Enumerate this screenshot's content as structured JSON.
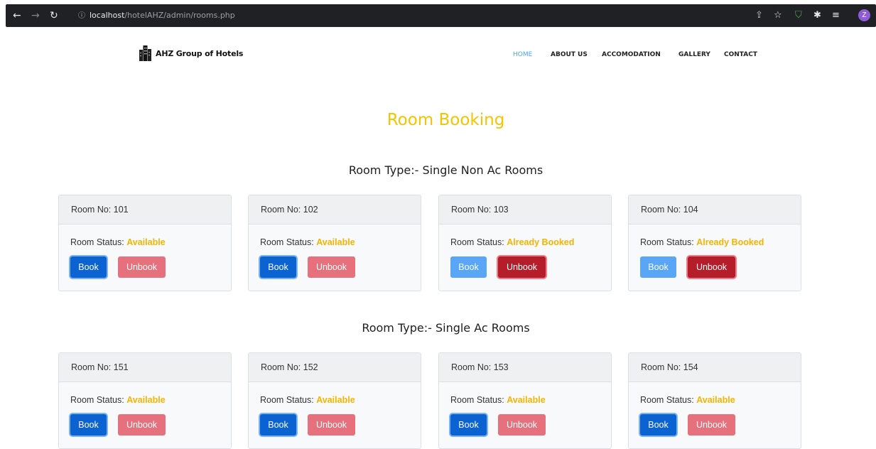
{
  "browser": {
    "url_host": "localhost",
    "url_path": "/hotelAHZ/admin/rooms.php",
    "profile_initial": "Z"
  },
  "site": {
    "brand": "AHZ Group of Hotels",
    "nav": [
      "HOME",
      "ABOUT US",
      "ACCOMODATION",
      "GALLERY",
      "CONTACT"
    ],
    "active_nav": "HOME"
  },
  "page": {
    "title": "Room Booking"
  },
  "sections": [
    {
      "heading": "Room Type:- Single Non Ac Rooms",
      "rooms": [
        {
          "label": "Room No: 101",
          "status_label": "Room Status:",
          "status": "Available",
          "book_enabled": true
        },
        {
          "label": "Room No: 102",
          "status_label": "Room Status:",
          "status": "Available",
          "book_enabled": true
        },
        {
          "label": "Room No: 103",
          "status_label": "Room Status:",
          "status": "Already Booked",
          "book_enabled": false
        },
        {
          "label": "Room No: 104",
          "status_label": "Room Status:",
          "status": "Already Booked",
          "book_enabled": false
        }
      ]
    },
    {
      "heading": "Room Type:- Single Ac Rooms",
      "rooms": [
        {
          "label": "Room No: 151",
          "status_label": "Room Status:",
          "status": "Available",
          "book_enabled": true
        },
        {
          "label": "Room No: 152",
          "status_label": "Room Status:",
          "status": "Available",
          "book_enabled": true
        },
        {
          "label": "Room No: 153",
          "status_label": "Room Status:",
          "status": "Available",
          "book_enabled": true
        },
        {
          "label": "Room No: 154",
          "status_label": "Room Status:",
          "status": "Available",
          "book_enabled": true
        }
      ]
    }
  ],
  "buttons": {
    "book": "Book",
    "unbook": "Unbook"
  },
  "colors": {
    "title": "#f5c400",
    "status": "#f5b400",
    "book": "#0b63d1",
    "unbook": "#b51d2a"
  }
}
